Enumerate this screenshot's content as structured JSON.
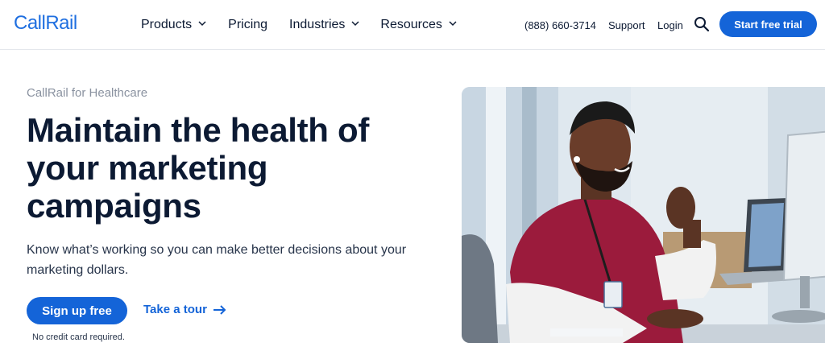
{
  "header": {
    "logo_text": "CallRail",
    "nav": [
      {
        "label": "Products",
        "has_dropdown": true
      },
      {
        "label": "Pricing",
        "has_dropdown": false
      },
      {
        "label": "Industries",
        "has_dropdown": true
      },
      {
        "label": "Resources",
        "has_dropdown": true
      }
    ],
    "phone": "(888) 660-3714",
    "support": "Support",
    "login": "Login",
    "search_icon": "search-icon",
    "cta": "Start free trial"
  },
  "hero": {
    "eyebrow": "CallRail for Healthcare",
    "headline": "Maintain the health of your marketing campaigns",
    "subtext": "Know what’s working so you can make better decisions about your marketing dollars.",
    "signup": "Sign up free",
    "tour": "Take a tour",
    "note": "No credit card required."
  },
  "colors": {
    "brand_blue": "#1464d8",
    "text_dark": "#0c1a33",
    "eyebrow_gray": "#8a92a0",
    "scrubs": "#9b1b3c"
  }
}
